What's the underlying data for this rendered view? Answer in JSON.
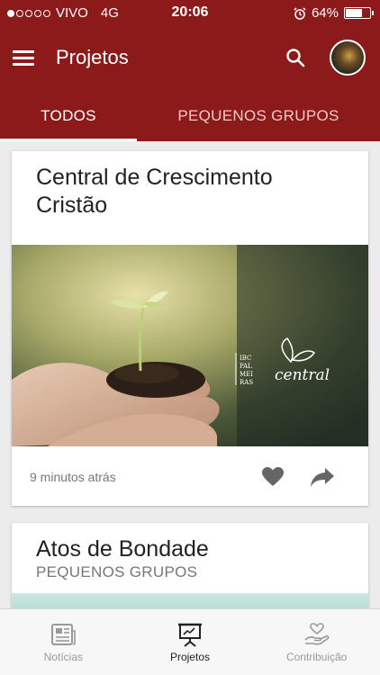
{
  "status_bar": {
    "carrier": "VIVO",
    "network": "4G",
    "time": "20:06",
    "battery": "64%",
    "battery_level": 0.64
  },
  "app_bar": {
    "title": "Projetos",
    "menu_icon": "hamburger-menu-icon",
    "search_icon": "search-icon",
    "avatar": "user-avatar"
  },
  "tabs": [
    {
      "label": "TODOS",
      "active": true
    },
    {
      "label": "PEQUENOS GRUPOS",
      "active": false
    }
  ],
  "cards": [
    {
      "title": "Central de Crescimento Cristão",
      "image_logo_text": [
        "IBC",
        "PAL",
        "MEI",
        "RAS"
      ],
      "image_brand": "central",
      "time": "9 minutos atrás",
      "like_icon": "heart-icon",
      "share_icon": "share-icon"
    },
    {
      "title": "Atos de Bondade",
      "subtitle": "PEQUENOS GRUPOS"
    }
  ],
  "bottom_nav": [
    {
      "label": "Notícias",
      "icon": "newspaper-icon",
      "active": false
    },
    {
      "label": "Projetos",
      "icon": "presentation-icon",
      "active": true
    },
    {
      "label": "Contribuição",
      "icon": "heart-hand-icon",
      "active": false
    }
  ],
  "colors": {
    "primary": "#8c1a1a",
    "background": "#ececec",
    "card": "#ffffff"
  }
}
